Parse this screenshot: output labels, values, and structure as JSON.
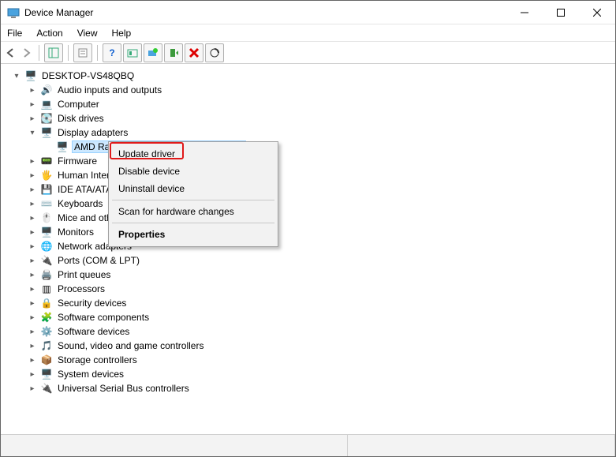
{
  "window": {
    "title": "Device Manager"
  },
  "menu": {
    "file": "File",
    "action": "Action",
    "view": "View",
    "help": "Help"
  },
  "tree": {
    "root": "DESKTOP-VS48QBQ",
    "items": [
      {
        "label": "Audio inputs and outputs"
      },
      {
        "label": "Computer"
      },
      {
        "label": "Disk drives"
      },
      {
        "label": "Display adapters",
        "expanded": true,
        "children": [
          {
            "label": "AMD Radeon(TM) RX Vega 11 Graphics",
            "selected": true
          }
        ]
      },
      {
        "label": "Firmware"
      },
      {
        "label": "Human Interface Devices"
      },
      {
        "label": "IDE ATA/ATAPI controllers"
      },
      {
        "label": "Keyboards"
      },
      {
        "label": "Mice and other pointing devices"
      },
      {
        "label": "Monitors"
      },
      {
        "label": "Network adapters"
      },
      {
        "label": "Ports (COM & LPT)"
      },
      {
        "label": "Print queues"
      },
      {
        "label": "Processors"
      },
      {
        "label": "Security devices"
      },
      {
        "label": "Software components"
      },
      {
        "label": "Software devices"
      },
      {
        "label": "Sound, video and game controllers"
      },
      {
        "label": "Storage controllers"
      },
      {
        "label": "System devices"
      },
      {
        "label": "Universal Serial Bus controllers"
      }
    ]
  },
  "context_menu": {
    "update": "Update driver",
    "disable": "Disable device",
    "uninstall": "Uninstall device",
    "scan": "Scan for hardware changes",
    "properties": "Properties"
  },
  "icons": {
    "audio": "🔊",
    "computer": "💻",
    "disk": "💽",
    "display": "🖥️",
    "firmware": "📟",
    "hid": "🖐️",
    "ide": "💾",
    "keyboard": "⌨️",
    "mouse": "🖱️",
    "monitor": "🖥️",
    "network": "🌐",
    "ports": "🔌",
    "print": "🖨️",
    "processor": "▥",
    "security": "🔒",
    "swcomp": "🧩",
    "swdev": "⚙️",
    "sound": "🎵",
    "storage": "📦",
    "system": "🖥️",
    "usb": "🔌",
    "rootpc": "🖥️",
    "gpu": "🖥️"
  }
}
